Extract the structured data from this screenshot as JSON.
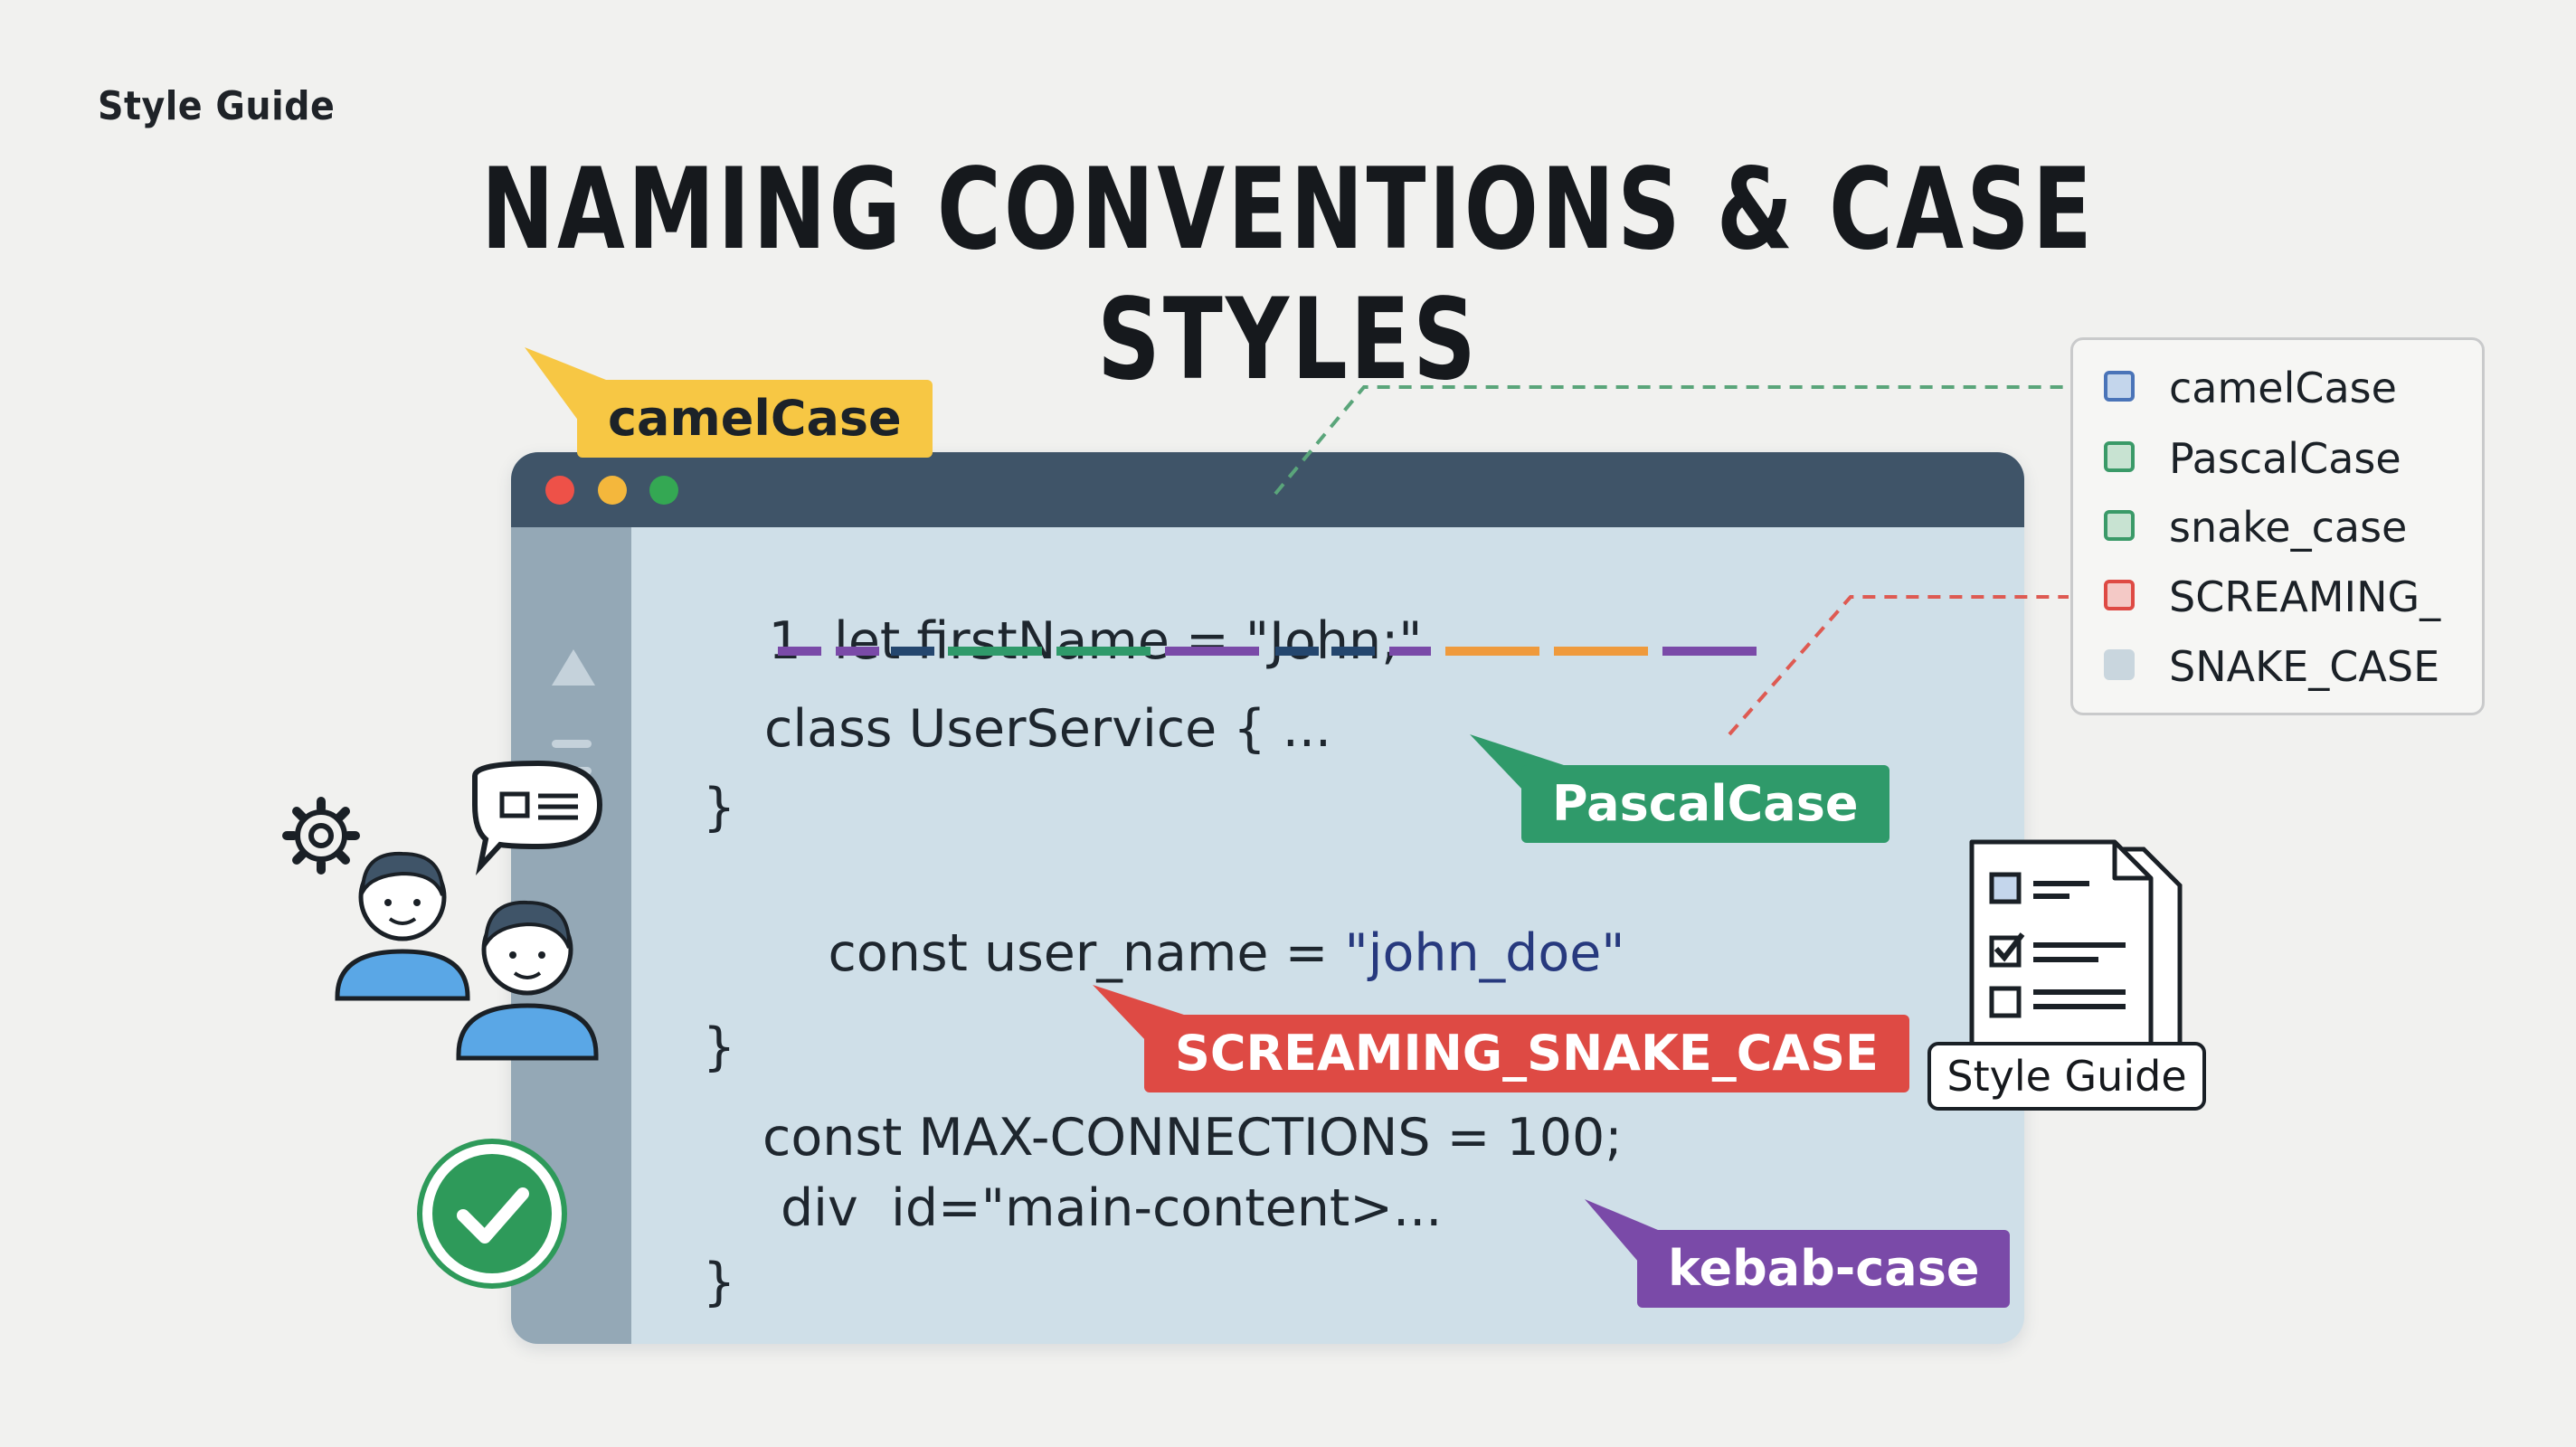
{
  "header": {
    "label": "Style Guide",
    "title": "NAMING CONVENTIONS & CASE STYLES"
  },
  "editor": {
    "lines": [
      {
        "number": "1",
        "text": "let firstName = \"John;\""
      },
      {
        "text": "class UserService { ..."
      },
      {
        "text": "}"
      },
      {
        "text": "const user_name = ",
        "string": "\"john_doe\""
      },
      {
        "text": "}"
      },
      {
        "text": "const MAX-CONNECTIONS = 100;"
      },
      {
        "text": "div  id=\"main-content>..."
      },
      {
        "text": "}"
      }
    ],
    "window_dots": [
      "red",
      "yellow",
      "green"
    ]
  },
  "tags": {
    "camel": {
      "label": "camelCase",
      "color": "#f7c744"
    },
    "pascal": {
      "label": "PascalCase",
      "color": "#2f9a6a"
    },
    "screaming": {
      "label": "SCREAMING_SNAKE_CASE",
      "color": "#de4a44"
    },
    "kebab": {
      "label": "kebab-case",
      "color": "#7a4aa8"
    }
  },
  "legend": {
    "items": [
      {
        "label": "camelCase",
        "color": "#4a74b8"
      },
      {
        "label": "PascalCase",
        "color": "#3a9a68"
      },
      {
        "label": "snake_case",
        "color": "#3a9a68"
      },
      {
        "label": "SCREAMING_",
        "color": "#de4a44"
      },
      {
        "label": "SNAKE_CASE",
        "color": "#c9d6de"
      }
    ]
  },
  "document_icon": {
    "caption": "Style Guide"
  },
  "colors": {
    "purple": "#7a4aa8",
    "navy": "#24466e",
    "green": "#2f9a6a",
    "orange": "#ef9a3c",
    "check": "#2e9a5a"
  }
}
